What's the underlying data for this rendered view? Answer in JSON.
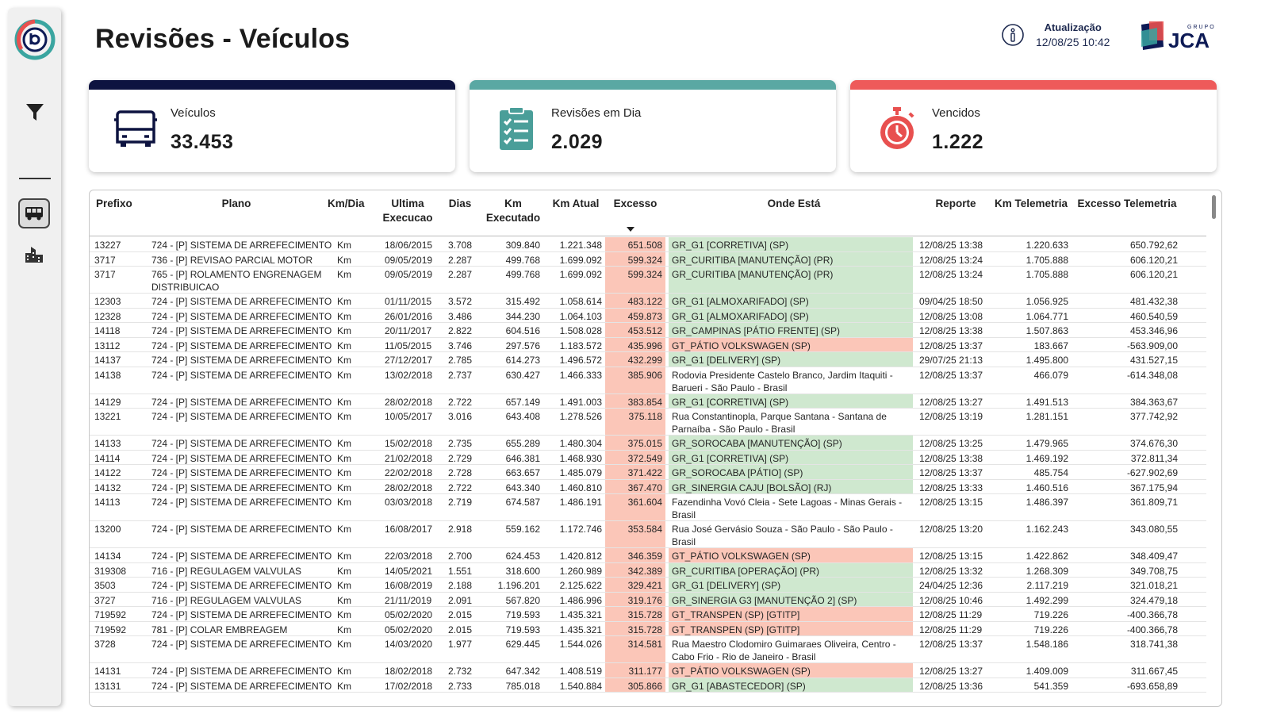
{
  "page": {
    "title": "Revisões - Veículos",
    "update_label": "Atualização",
    "update_value": "12/08/25 10:42",
    "brand_top": "GRUPO",
    "brand_main": "JCA"
  },
  "colors": {
    "card_vehicles": "#0d1340",
    "card_ontime": "#5aa8a3",
    "card_overdue": "#ee5a5a",
    "excess_bg": "#fbc6b8",
    "location_ok": "#cfe8cf",
    "location_bad": "#fbc6b8"
  },
  "kpis": [
    {
      "label": "Veículos",
      "value": "33.453",
      "icon": "bus-icon"
    },
    {
      "label": "Revisões em Dia",
      "value": "2.029",
      "icon": "checklist-icon"
    },
    {
      "label": "Vencidos",
      "value": "1.222",
      "icon": "stopwatch-icon"
    }
  ],
  "table": {
    "columns": [
      "Prefixo",
      "Plano",
      "Km/Dia",
      "Ultima Execucao",
      "Dias",
      "Km Executado",
      "Km Atual",
      "Excesso",
      "Onde Está",
      "Reporte",
      "Km Telemetria",
      "Excesso Telemetria"
    ],
    "sort_column": "Excesso",
    "rows": [
      {
        "prefixo": "13227",
        "plano": "724 - [P] SISTEMA DE ARREFECIMENTO",
        "kmdia": "Km",
        "ultima": "18/06/2015",
        "dias": "3.708",
        "kmexec": "309.840",
        "kmatual": "1.221.348",
        "excesso": "651.508",
        "onde": "GR_G1 [CORRETIVA] (SP)",
        "status": "ok",
        "reporte": "12/08/25 13:38",
        "kmtel": "1.220.633",
        "exctel": "650.792,62"
      },
      {
        "prefixo": "3717",
        "plano": "736 - [P] REVISAO PARCIAL MOTOR",
        "kmdia": "Km",
        "ultima": "09/05/2019",
        "dias": "2.287",
        "kmexec": "499.768",
        "kmatual": "1.699.092",
        "excesso": "599.324",
        "onde": "GR_CURITIBA [MANUTENÇÃO] (PR)",
        "status": "ok",
        "reporte": "12/08/25 13:24",
        "kmtel": "1.705.888",
        "exctel": "606.120,21"
      },
      {
        "prefixo": "3717",
        "plano": "765 - [P] ROLAMENTO ENGRENAGEM DISTRIBUICAO",
        "kmdia": "Km",
        "ultima": "09/05/2019",
        "dias": "2.287",
        "kmexec": "499.768",
        "kmatual": "1.699.092",
        "excesso": "599.324",
        "onde": "GR_CURITIBA [MANUTENÇÃO] (PR)",
        "status": "ok",
        "reporte": "12/08/25 13:24",
        "kmtel": "1.705.888",
        "exctel": "606.120,21"
      },
      {
        "prefixo": "12303",
        "plano": "724 - [P] SISTEMA DE ARREFECIMENTO",
        "kmdia": "Km",
        "ultima": "01/11/2015",
        "dias": "3.572",
        "kmexec": "315.492",
        "kmatual": "1.058.614",
        "excesso": "483.122",
        "onde": "GR_G1 [ALMOXARIFADO] (SP)",
        "status": "ok",
        "reporte": "09/04/25 18:50",
        "kmtel": "1.056.925",
        "exctel": "481.432,38"
      },
      {
        "prefixo": "12328",
        "plano": "724 - [P] SISTEMA DE ARREFECIMENTO",
        "kmdia": "Km",
        "ultima": "26/01/2016",
        "dias": "3.486",
        "kmexec": "344.230",
        "kmatual": "1.064.103",
        "excesso": "459.873",
        "onde": "GR_G1 [ALMOXARIFADO] (SP)",
        "status": "ok",
        "reporte": "12/08/25 13:08",
        "kmtel": "1.064.771",
        "exctel": "460.540,59"
      },
      {
        "prefixo": "14118",
        "plano": "724 - [P] SISTEMA DE ARREFECIMENTO",
        "kmdia": "Km",
        "ultima": "20/11/2017",
        "dias": "2.822",
        "kmexec": "604.516",
        "kmatual": "1.508.028",
        "excesso": "453.512",
        "onde": "GR_CAMPINAS [PÁTIO FRENTE] (SP)",
        "status": "ok",
        "reporte": "12/08/25 13:38",
        "kmtel": "1.507.863",
        "exctel": "453.346,96"
      },
      {
        "prefixo": "13112",
        "plano": "724 - [P] SISTEMA DE ARREFECIMENTO",
        "kmdia": "Km",
        "ultima": "11/05/2015",
        "dias": "3.746",
        "kmexec": "297.576",
        "kmatual": "1.183.572",
        "excesso": "435.996",
        "onde": "GT_PÁTIO VOLKSWAGEN (SP)",
        "status": "bad",
        "reporte": "12/08/25 13:37",
        "kmtel": "183.667",
        "exctel": "-563.909,00"
      },
      {
        "prefixo": "14137",
        "plano": "724 - [P] SISTEMA DE ARREFECIMENTO",
        "kmdia": "Km",
        "ultima": "27/12/2017",
        "dias": "2.785",
        "kmexec": "614.273",
        "kmatual": "1.496.572",
        "excesso": "432.299",
        "onde": "GR_G1 [DELIVERY] (SP)",
        "status": "ok",
        "reporte": "29/07/25 21:13",
        "kmtel": "1.495.800",
        "exctel": "431.527,15"
      },
      {
        "prefixo": "14138",
        "plano": "724 - [P] SISTEMA DE ARREFECIMENTO",
        "kmdia": "Km",
        "ultima": "13/02/2018",
        "dias": "2.737",
        "kmexec": "630.427",
        "kmatual": "1.466.333",
        "excesso": "385.906",
        "onde": "Rodovia Presidente Castelo Branco, Jardim Itaquiti - Barueri - São Paulo - Brasil",
        "status": "none",
        "reporte": "12/08/25 13:37",
        "kmtel": "466.079",
        "exctel": "-614.348,08"
      },
      {
        "prefixo": "14129",
        "plano": "724 - [P] SISTEMA DE ARREFECIMENTO",
        "kmdia": "Km",
        "ultima": "28/02/2018",
        "dias": "2.722",
        "kmexec": "657.149",
        "kmatual": "1.491.003",
        "excesso": "383.854",
        "onde": "GR_G1 [CORRETIVA] (SP)",
        "status": "ok",
        "reporte": "12/08/25 13:27",
        "kmtel": "1.491.513",
        "exctel": "384.363,67"
      },
      {
        "prefixo": "13221",
        "plano": "724 - [P] SISTEMA DE ARREFECIMENTO",
        "kmdia": "Km",
        "ultima": "10/05/2017",
        "dias": "3.016",
        "kmexec": "643.408",
        "kmatual": "1.278.526",
        "excesso": "375.118",
        "onde": "Rua Constantinopla, Parque Santana - Santana de Parnaíba - São Paulo - Brasil",
        "status": "none",
        "reporte": "12/08/25 13:19",
        "kmtel": "1.281.151",
        "exctel": "377.742,92"
      },
      {
        "prefixo": "14133",
        "plano": "724 - [P] SISTEMA DE ARREFECIMENTO",
        "kmdia": "Km",
        "ultima": "15/02/2018",
        "dias": "2.735",
        "kmexec": "655.289",
        "kmatual": "1.480.304",
        "excesso": "375.015",
        "onde": "GR_SOROCABA [MANUTENÇÃO] (SP)",
        "status": "ok",
        "reporte": "12/08/25 13:25",
        "kmtel": "1.479.965",
        "exctel": "374.676,30"
      },
      {
        "prefixo": "14114",
        "plano": "724 - [P] SISTEMA DE ARREFECIMENTO",
        "kmdia": "Km",
        "ultima": "21/02/2018",
        "dias": "2.729",
        "kmexec": "646.381",
        "kmatual": "1.468.930",
        "excesso": "372.549",
        "onde": "GR_G1 [CORRETIVA] (SP)",
        "status": "ok",
        "reporte": "12/08/25 13:38",
        "kmtel": "1.469.192",
        "exctel": "372.811,34"
      },
      {
        "prefixo": "14122",
        "plano": "724 - [P] SISTEMA DE ARREFECIMENTO",
        "kmdia": "Km",
        "ultima": "22/02/2018",
        "dias": "2.728",
        "kmexec": "663.657",
        "kmatual": "1.485.079",
        "excesso": "371.422",
        "onde": "GR_SOROCABA [PÁTIO] (SP)",
        "status": "ok",
        "reporte": "12/08/25 13:37",
        "kmtel": "485.754",
        "exctel": "-627.902,69"
      },
      {
        "prefixo": "14132",
        "plano": "724 - [P] SISTEMA DE ARREFECIMENTO",
        "kmdia": "Km",
        "ultima": "28/02/2018",
        "dias": "2.722",
        "kmexec": "643.340",
        "kmatual": "1.460.810",
        "excesso": "367.470",
        "onde": "GR_SINERGIA CAJU [BOLSÃO] (RJ)",
        "status": "ok",
        "reporte": "12/08/25 13:33",
        "kmtel": "1.460.516",
        "exctel": "367.175,94"
      },
      {
        "prefixo": "14113",
        "plano": "724 - [P] SISTEMA DE ARREFECIMENTO",
        "kmdia": "Km",
        "ultima": "03/03/2018",
        "dias": "2.719",
        "kmexec": "674.587",
        "kmatual": "1.486.191",
        "excesso": "361.604",
        "onde": "Fazendinha Vovó Cleia - Sete Lagoas - Minas Gerais - Brasil",
        "status": "none",
        "reporte": "12/08/25 13:15",
        "kmtel": "1.486.397",
        "exctel": "361.809,71"
      },
      {
        "prefixo": "13200",
        "plano": "724 - [P] SISTEMA DE ARREFECIMENTO",
        "kmdia": "Km",
        "ultima": "16/08/2017",
        "dias": "2.918",
        "kmexec": "559.162",
        "kmatual": "1.172.746",
        "excesso": "353.584",
        "onde": "Rua José Gervásio Souza - São Paulo - São Paulo - Brasil",
        "status": "none",
        "reporte": "12/08/25 13:20",
        "kmtel": "1.162.243",
        "exctel": "343.080,55"
      },
      {
        "prefixo": "14134",
        "plano": "724 - [P] SISTEMA DE ARREFECIMENTO",
        "kmdia": "Km",
        "ultima": "22/03/2018",
        "dias": "2.700",
        "kmexec": "624.453",
        "kmatual": "1.420.812",
        "excesso": "346.359",
        "onde": "GT_PÁTIO VOLKSWAGEN (SP)",
        "status": "bad",
        "reporte": "12/08/25 13:15",
        "kmtel": "1.422.862",
        "exctel": "348.409,47"
      },
      {
        "prefixo": "319308",
        "plano": "716 - [P] REGULAGEM VALVULAS",
        "kmdia": "Km",
        "ultima": "14/05/2021",
        "dias": "1.551",
        "kmexec": "318.600",
        "kmatual": "1.260.989",
        "excesso": "342.389",
        "onde": "GR_CURITIBA [OPERAÇÃO] (PR)",
        "status": "ok",
        "reporte": "12/08/25 13:32",
        "kmtel": "1.268.309",
        "exctel": "349.708,75"
      },
      {
        "prefixo": "3503",
        "plano": "724 - [P] SISTEMA DE ARREFECIMENTO",
        "kmdia": "Km",
        "ultima": "16/08/2019",
        "dias": "2.188",
        "kmexec": "1.196.201",
        "kmatual": "2.125.622",
        "excesso": "329.421",
        "onde": "GR_G1 [DELIVERY] (SP)",
        "status": "ok",
        "reporte": "24/04/25 12:36",
        "kmtel": "2.117.219",
        "exctel": "321.018,21"
      },
      {
        "prefixo": "3727",
        "plano": "716 - [P] REGULAGEM VALVULAS",
        "kmdia": "Km",
        "ultima": "21/11/2019",
        "dias": "2.091",
        "kmexec": "567.820",
        "kmatual": "1.486.996",
        "excesso": "319.176",
        "onde": "GR_SINERGIA G3 [MANUTENÇÃO 2] (SP)",
        "status": "ok",
        "reporte": "12/08/25 10:46",
        "kmtel": "1.492.299",
        "exctel": "324.479,18"
      },
      {
        "prefixo": "719592",
        "plano": "724 - [P] SISTEMA DE ARREFECIMENTO",
        "kmdia": "Km",
        "ultima": "05/02/2020",
        "dias": "2.015",
        "kmexec": "719.593",
        "kmatual": "1.435.321",
        "excesso": "315.728",
        "onde": "GT_TRANSPEN (SP) [GTITP]",
        "status": "bad",
        "reporte": "12/08/25 11:29",
        "kmtel": "719.226",
        "exctel": "-400.366,78"
      },
      {
        "prefixo": "719592",
        "plano": "781 - [P] COLAR EMBREAGEM",
        "kmdia": "Km",
        "ultima": "05/02/2020",
        "dias": "2.015",
        "kmexec": "719.593",
        "kmatual": "1.435.321",
        "excesso": "315.728",
        "onde": "GT_TRANSPEN (SP) [GTITP]",
        "status": "bad",
        "reporte": "12/08/25 11:29",
        "kmtel": "719.226",
        "exctel": "-400.366,78"
      },
      {
        "prefixo": "3728",
        "plano": "724 - [P] SISTEMA DE ARREFECIMENTO",
        "kmdia": "Km",
        "ultima": "14/03/2020",
        "dias": "1.977",
        "kmexec": "629.445",
        "kmatual": "1.544.026",
        "excesso": "314.581",
        "onde": "Rua Maestro Clodomiro Guimaraes Oliveira, Centro - Cabo Frio - Rio de Janeiro - Brasil",
        "status": "none",
        "reporte": "12/08/25 13:37",
        "kmtel": "1.548.186",
        "exctel": "318.741,38"
      },
      {
        "prefixo": "14131",
        "plano": "724 - [P] SISTEMA DE ARREFECIMENTO",
        "kmdia": "Km",
        "ultima": "18/02/2018",
        "dias": "2.732",
        "kmexec": "647.342",
        "kmatual": "1.408.519",
        "excesso": "311.177",
        "onde": "GT_PÁTIO VOLKSWAGEN (SP)",
        "status": "bad",
        "reporte": "12/08/25 13:27",
        "kmtel": "1.409.009",
        "exctel": "311.667,45"
      },
      {
        "prefixo": "13131",
        "plano": "724 - [P] SISTEMA DE ARREFECIMENTO",
        "kmdia": "Km",
        "ultima": "17/02/2018",
        "dias": "2.733",
        "kmexec": "785.018",
        "kmatual": "1.540.884",
        "excesso": "305.866",
        "onde": "GR_G1 [ABASTECEDOR] (SP)",
        "status": "ok",
        "reporte": "12/08/25 13:36",
        "kmtel": "541.359",
        "exctel": "-693.658,89"
      }
    ]
  }
}
